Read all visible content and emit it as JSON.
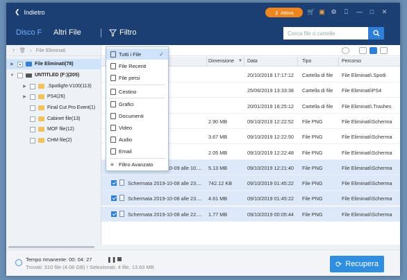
{
  "topbar": {
    "back_label": "Indietro",
    "activate_label": "Attiva"
  },
  "toolbar": {
    "tab1": "Disco F",
    "tab2": "Altri File",
    "filter_label": "Filtro",
    "search_placeholder": "Cerca file o cartelle"
  },
  "breadcrumb": "File Eliminati",
  "tree": [
    {
      "label": "File Eliminati(78)",
      "level": 0
    },
    {
      "label": "UNTITLED (F:)(205)",
      "level": 0
    },
    {
      "label": ".Spotlight-V100(113)",
      "level": 1
    },
    {
      "label": "PS4(26)",
      "level": 1
    },
    {
      "label": "Final Cut Pro Event(1)",
      "level": 1
    },
    {
      "label": "Cabinet file(13)",
      "level": 1
    },
    {
      "label": "MOF file(12)",
      "level": 1
    },
    {
      "label": "CHM file(2)",
      "level": 1
    }
  ],
  "filter_menu": [
    {
      "label": "Tutti i File",
      "checked": true
    },
    {
      "label": "File Recenti"
    },
    {
      "label": "File persi"
    },
    {
      "label": "Cestino"
    },
    {
      "label": "Grafici"
    },
    {
      "label": "Documenti"
    },
    {
      "label": "Video"
    },
    {
      "label": "Audio"
    },
    {
      "label": "Email"
    },
    {
      "label": "Filtro Avanzato"
    }
  ],
  "columns": {
    "dimensione": "Dimensione",
    "data": "Data",
    "tipo": "Tipo",
    "percorso": "Percorso"
  },
  "rows": [
    {
      "name": "",
      "size": "",
      "date": "20/10/2018 17:17:12",
      "type": "Cartella di file",
      "path": "File Eliminati\\.Spotli",
      "checked": false
    },
    {
      "name": "",
      "size": "",
      "date": "25/06/2019 13:33:38",
      "type": "Cartella di file",
      "path": "File Eliminati\\PS4",
      "checked": false
    },
    {
      "name": "",
      "size": "",
      "date": "20/01/2019 16:25:12",
      "type": "Cartella di file",
      "path": "File Eliminati\\.Trashes",
      "checked": false
    },
    {
      "name": "-10-09 alle 10....",
      "size": "2.90 MB",
      "date": "09/10/2019 12:22:52",
      "type": "File PNG",
      "path": "File Eliminati\\Scherma",
      "checked": false
    },
    {
      "name": "-10-09 alle 10....",
      "size": "3.67 MB",
      "date": "09/10/2019 12:22:50",
      "type": "File PNG",
      "path": "File Eliminati\\Scherma",
      "checked": false
    },
    {
      "name": "-10-09 alle 10....",
      "size": "2.05 MB",
      "date": "09/10/2019 12:22:48",
      "type": "File PNG",
      "path": "File Eliminati\\Scherma",
      "checked": false
    },
    {
      "name": "Schermata 2019-10-09 alle 10....",
      "size": "5.13 MB",
      "date": "09/10/2019 12:21:40",
      "type": "File PNG",
      "path": "File Eliminati\\Scherma",
      "checked": true
    },
    {
      "name": "Schermata 2019-10-08 alle 23....",
      "size": "742.12 KB",
      "date": "09/10/2019 01:45:22",
      "type": "File PNG",
      "path": "File Eliminati\\Scherma",
      "checked": true
    },
    {
      "name": "Schermata 2019-10-08 alle 23....",
      "size": "4.61 MB",
      "date": "09/10/2019 01:45:22",
      "type": "File PNG",
      "path": "File Eliminati\\Scherma",
      "checked": true
    },
    {
      "name": "Schermata 2019-10-08 alle 22....",
      "size": "1.77 MB",
      "date": "09/10/2019 00:05:44",
      "type": "File PNG",
      "path": "File Eliminati\\Scherma",
      "checked": true
    }
  ],
  "status": {
    "time_remaining": "Tempo rimanente: 00: 04: 27",
    "found": "Trovati: 310 file (4.08 GB) / Selezionati: 4 file, 13.63 MB",
    "pause_glyph": "❚❚"
  },
  "recover_label": "Recupera"
}
